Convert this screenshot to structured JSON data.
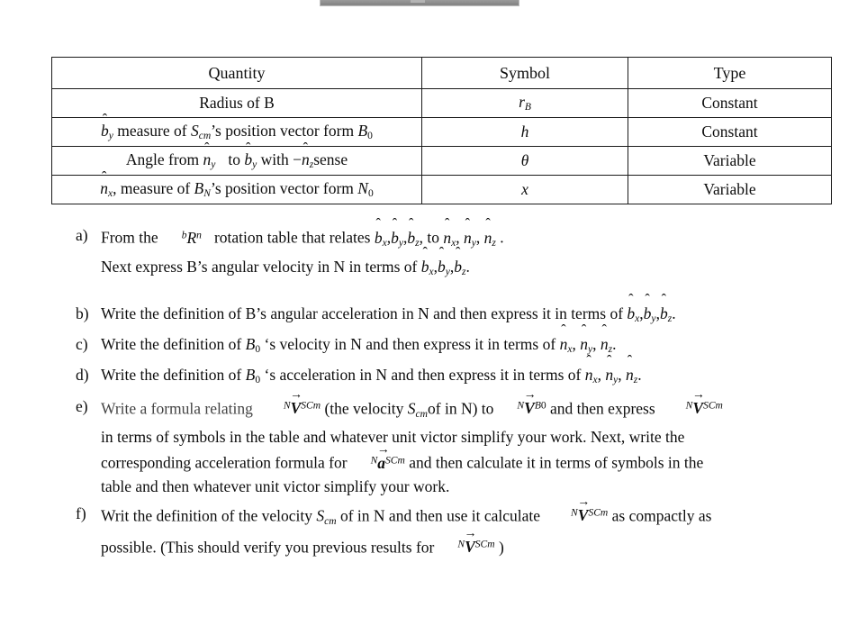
{
  "document": {
    "type": "homework-problem-sheet",
    "table": {
      "headers": [
        "Quantity",
        "Symbol",
        "Type"
      ],
      "rows": [
        {
          "quantity_plain": "Radius of B",
          "symbol_plain": "r_B",
          "type": "Constant"
        },
        {
          "quantity_plain": "b̂_y measure of S_cm's position vector form B_0",
          "symbol_plain": "h",
          "type": "Constant"
        },
        {
          "quantity_plain": "Angle from n̂_y to b̂_y with −n̂_z sense",
          "symbol_plain": "θ",
          "type": "Variable"
        },
        {
          "quantity_plain": "n̂_x, measure of B_N's position vector form N_0",
          "symbol_plain": "x",
          "type": "Variable"
        }
      ],
      "cells": {
        "r0": {
          "q_text": "Radius of B",
          "type": "Constant"
        },
        "r1": {
          "q_t1": " measure of ",
          "q_t2": "’s position vector form ",
          "sym": "h",
          "type": "Constant"
        },
        "r2": {
          "q_t1": "Angle from ",
          "q_t2": "to ",
          "q_t3": "with −",
          "q_t4": "sense",
          "sym": "θ",
          "type": "Variable"
        },
        "r3": {
          "q_t1": ", measure of ",
          "q_t2": "’s position vector form ",
          "sym": "x",
          "type": "Variable"
        }
      }
    },
    "questions": [
      {
        "label": "a)",
        "lines": [
          "From the  ᵇRⁿ rotation table that relates b̂x,b̂y,b̂z, to n̂x, n̂y, n̂z .",
          "Next express B’s angular velocity in N in terms of b̂x,b̂y,b̂z."
        ]
      },
      {
        "label": "b)",
        "lines": [
          "Write the definition of B’s angular acceleration in N and then express it in terms of b̂x,b̂y,b̂z."
        ]
      },
      {
        "label": "c)",
        "lines": [
          "Write the definition of B0 ‘s velocity in N and then express it in terms of  n̂x, n̂y, n̂z."
        ]
      },
      {
        "label": "d)",
        "lines": [
          "Write the definition of B0 ‘s acceleration in N and then express it in terms of  n̂x, n̂y, n̂z."
        ]
      },
      {
        "label": "e)",
        "lines": [
          "Write a formula relating  ᴺV⃗ˢᶜᵐ (the velocity Scmof in N) to  ᴺV⃗ᴮ₀ and then express  ᴺV⃗ˢᶜᵐ",
          "in terms of symbols in the table and whatever unit victor simplify your work. Next, write the",
          "corresponding acceleration formula for  ᴺa⃗ˢᶜᵐ and then calculate it in terms of symbols in the",
          "table and then whatever unit victor simplify your work."
        ]
      },
      {
        "label": "f)",
        "lines": [
          "Writ the definition of the velocity Scm of in N and then use it calculate  ᴺV⃗ˢᶜᵐ as compactly as",
          "possible. (This should verify you previous results for  ᴺV⃗ˢᶜᵐ )"
        ]
      }
    ],
    "q_fragments": {
      "a1_t1": "From the",
      "a1_t2": "rotation table that relates ",
      "a1_t3": ", to ",
      "a1_t4": " .",
      "a2_t1": "Next express B’s angular velocity in N in terms of ",
      "a2_t2": ".",
      "b_t1": "Write the definition of B’s angular acceleration in N and then express it in terms of ",
      "b_t2": ".",
      "c_t1": "Write the definition of ",
      "c_t2": " ‘s velocity in N and then express it in terms of ",
      "c_t3": ".",
      "d_t1": "Write the definition of ",
      "d_t2": " ‘s acceleration in N and then express it in terms of ",
      "d_t3": ".",
      "e1_t1": "Write a formula relating",
      "e1_t2": " (the velocity ",
      "e1_t3": "of in N) to",
      "e1_t4": " and then express",
      "e2": "in terms of symbols in the table and whatever unit victor simplify your work. Next, write the",
      "e3_t1": "corresponding acceleration formula for",
      "e3_t2": " and then calculate it in terms of symbols in the",
      "e4": "table and then whatever unit victor simplify your work.",
      "f1_t1": "Writ the definition of the velocity ",
      "f1_t2": " of in N and then use it calculate",
      "f1_t3": " as compactly as",
      "f2_t1": "possible. (This should verify you previous results for",
      "f2_t2": " )"
    },
    "symbols": {
      "hat": "̂",
      "hat_glyph": "ˆ",
      "vec_arrow": "→",
      "theta": "θ",
      "minus": "−",
      "b": "b",
      "n": "n",
      "r": "r",
      "h": "h",
      "x": "x",
      "V": "V",
      "a": "a",
      "R": "R",
      "S": "S",
      "B": "B",
      "N": "N",
      "sub_x": "x",
      "sub_y": "y",
      "sub_z": "z",
      "sub_cm": "cm",
      "sub_Cm": "Cm",
      "sub_B": "B",
      "sub_N": "N",
      "sub_0": "0",
      "sup_b": "b",
      "sup_n": "n",
      "sup_N": "N",
      "comma": ","
    },
    "colors": {
      "text": "#0d0d0d",
      "rule": "#1b1b1b",
      "page_bg": "#ffffff",
      "toolbar_gray": "#8e8e8e"
    }
  }
}
